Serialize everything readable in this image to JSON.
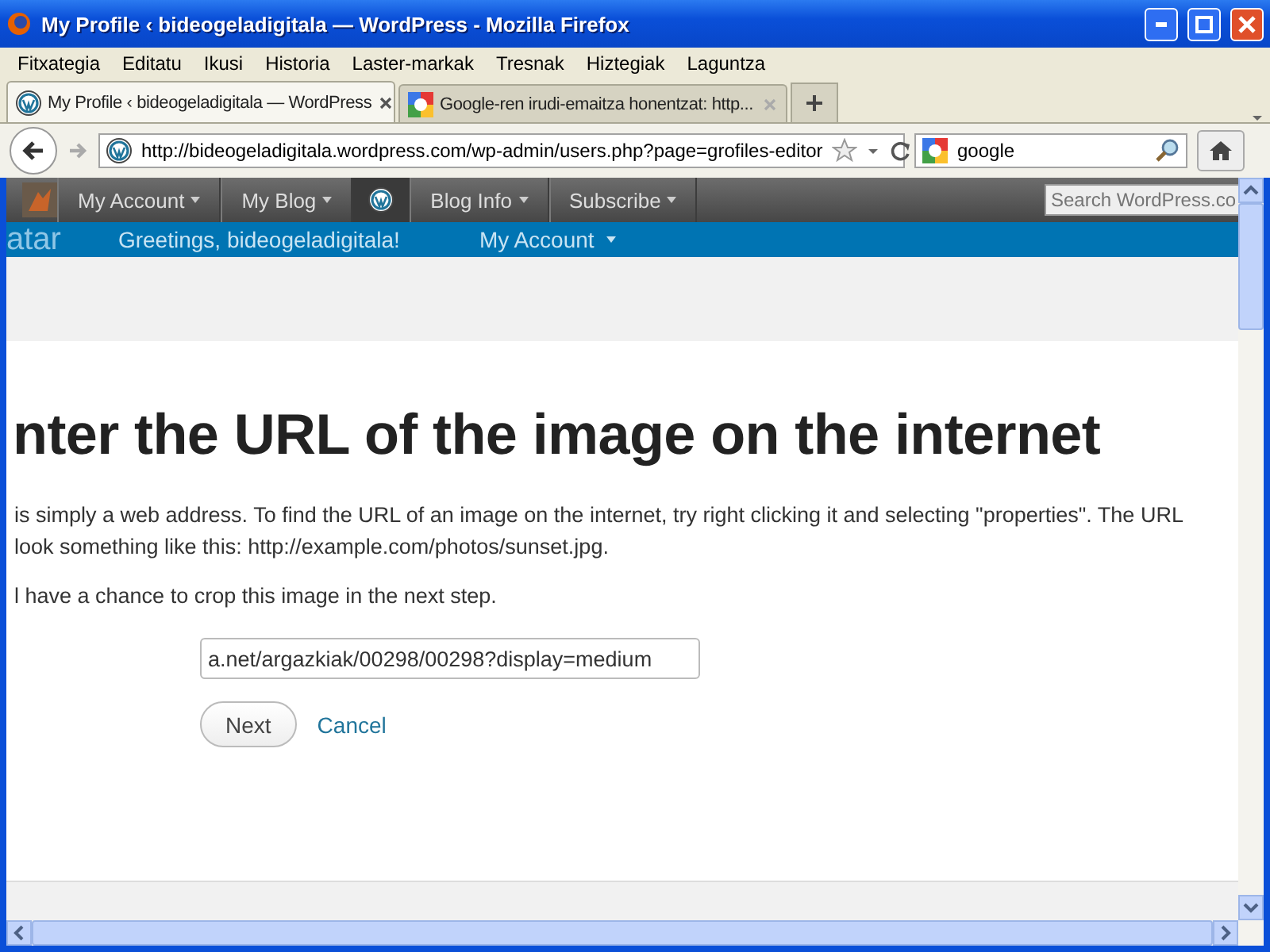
{
  "window": {
    "title": "My Profile ‹ bideogeladigitala — WordPress - Mozilla Firefox"
  },
  "menu": [
    "Fitxategia",
    "Editatu",
    "Ikusi",
    "Historia",
    "Laster-markak",
    "Tresnak",
    "Hiztegiak",
    "Laguntza"
  ],
  "tabs": [
    {
      "label": "My Profile ‹ bideogeladigitala — WordPress",
      "selected": true
    },
    {
      "label": "Google-ren irudi-emaitza honentzat: http...",
      "selected": false
    }
  ],
  "address": {
    "value": "http://bideogeladigitala.wordpress.com/wp-admin/users.php?page=grofiles-editor"
  },
  "search": {
    "value": "google"
  },
  "admin_bar": {
    "items": [
      {
        "kind": "menu",
        "label": "My Account"
      },
      {
        "kind": "menu",
        "label": "My Blog"
      },
      {
        "kind": "logo"
      },
      {
        "kind": "menu",
        "label": "Blog Info"
      },
      {
        "kind": "menu",
        "label": "Subscribe"
      }
    ],
    "search": {
      "placeholder": "Search WordPress.co"
    }
  },
  "header": {
    "logo": "atar",
    "greeting": "Greetings, bideogeladigitala!",
    "account": "My Account"
  },
  "content": {
    "heading": "nter the URL of the image on the internet",
    "lines": [
      "is simply a web address. To find the URL of an image on the internet, try right clicking it and selecting \"properties\". The URL",
      "look something like this: http://example.com/photos/sunset.jpg.",
      "l have a chance to crop this image in the next step."
    ],
    "url_field": {
      "value": "a.net/argazkiak/00298/00298?display=medium"
    },
    "next": "Next",
    "cancel": "Cancel"
  }
}
